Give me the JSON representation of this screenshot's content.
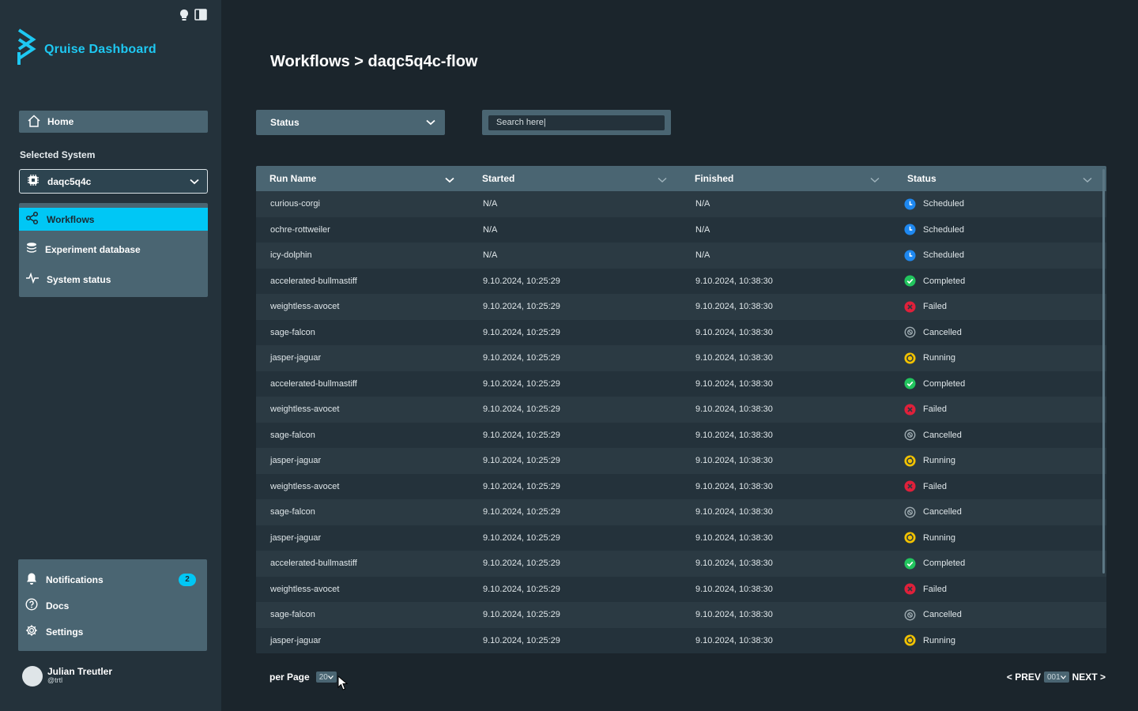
{
  "app": {
    "title": "Qruise Dashboard"
  },
  "sidebar": {
    "home_label": "Home",
    "selected_system_label": "Selected System",
    "system_value": "daqc5q4c",
    "nav": [
      {
        "label": "Workflows",
        "icon": "workflow-icon",
        "active": true
      },
      {
        "label": "Experiment database",
        "icon": "database-icon",
        "active": false
      },
      {
        "label": "System status",
        "icon": "pulse-icon",
        "active": false
      }
    ],
    "bottom": [
      {
        "label": "Notifications",
        "icon": "bell-icon",
        "badge": "2"
      },
      {
        "label": "Docs",
        "icon": "help-circle-icon"
      },
      {
        "label": "Settings",
        "icon": "gear-icon"
      }
    ],
    "user": {
      "name": "Julian Treutler",
      "handle": "@trtl"
    }
  },
  "main": {
    "title": "Workflows > daqc5q4c-flow",
    "status_filter_label": "Status",
    "search_placeholder": "Search here|",
    "columns": [
      "Run Name",
      "Started",
      "Finished",
      "Status"
    ],
    "rows": [
      {
        "name": "curious-corgi",
        "started": "N/A",
        "finished": "N/A",
        "status": "Scheduled"
      },
      {
        "name": "ochre-rottweiler",
        "started": "N/A",
        "finished": "N/A",
        "status": "Scheduled"
      },
      {
        "name": "icy-dolphin",
        "started": "N/A",
        "finished": "N/A",
        "status": "Scheduled"
      },
      {
        "name": "accelerated-bullmastiff",
        "started": "9.10.2024, 10:25:29",
        "finished": "9.10.2024, 10:38:30",
        "status": "Completed"
      },
      {
        "name": "weightless-avocet",
        "started": "9.10.2024, 10:25:29",
        "finished": "9.10.2024, 10:38:30",
        "status": "Failed"
      },
      {
        "name": "sage-falcon",
        "started": "9.10.2024, 10:25:29",
        "finished": "9.10.2024, 10:38:30",
        "status": "Cancelled"
      },
      {
        "name": "jasper-jaguar",
        "started": "9.10.2024, 10:25:29",
        "finished": "9.10.2024, 10:38:30",
        "status": "Running"
      },
      {
        "name": "accelerated-bullmastiff",
        "started": "9.10.2024, 10:25:29",
        "finished": "9.10.2024, 10:38:30",
        "status": "Completed"
      },
      {
        "name": "weightless-avocet",
        "started": "9.10.2024, 10:25:29",
        "finished": "9.10.2024, 10:38:30",
        "status": "Failed"
      },
      {
        "name": "sage-falcon",
        "started": "9.10.2024, 10:25:29",
        "finished": "9.10.2024, 10:38:30",
        "status": "Cancelled"
      },
      {
        "name": "jasper-jaguar",
        "started": "9.10.2024, 10:25:29",
        "finished": "9.10.2024, 10:38:30",
        "status": "Running"
      },
      {
        "name": "weightless-avocet",
        "started": "9.10.2024, 10:25:29",
        "finished": "9.10.2024, 10:38:30",
        "status": "Failed"
      },
      {
        "name": "sage-falcon",
        "started": "9.10.2024, 10:25:29",
        "finished": "9.10.2024, 10:38:30",
        "status": "Cancelled"
      },
      {
        "name": "jasper-jaguar",
        "started": "9.10.2024, 10:25:29",
        "finished": "9.10.2024, 10:38:30",
        "status": "Running"
      },
      {
        "name": "accelerated-bullmastiff",
        "started": "9.10.2024, 10:25:29",
        "finished": "9.10.2024, 10:38:30",
        "status": "Completed"
      },
      {
        "name": "weightless-avocet",
        "started": "9.10.2024, 10:25:29",
        "finished": "9.10.2024, 10:38:30",
        "status": "Failed"
      },
      {
        "name": "sage-falcon",
        "started": "9.10.2024, 10:25:29",
        "finished": "9.10.2024, 10:38:30",
        "status": "Cancelled"
      },
      {
        "name": "jasper-jaguar",
        "started": "9.10.2024, 10:25:29",
        "finished": "9.10.2024, 10:38:30",
        "status": "Running"
      }
    ],
    "status_colors": {
      "Scheduled": "#1e88f0",
      "Completed": "#22c55e",
      "Failed": "#e0203a",
      "Cancelled": "#9aa7ad",
      "Running": "#f2c200"
    },
    "per_page_label": "per Page",
    "per_page_value": "20",
    "prev_label": "< PREV",
    "page_value": "001",
    "next_label": "NEXT >"
  },
  "colors": {
    "accent": "#00c7f5",
    "panel": "#4a6572",
    "background": "#1b252c"
  }
}
